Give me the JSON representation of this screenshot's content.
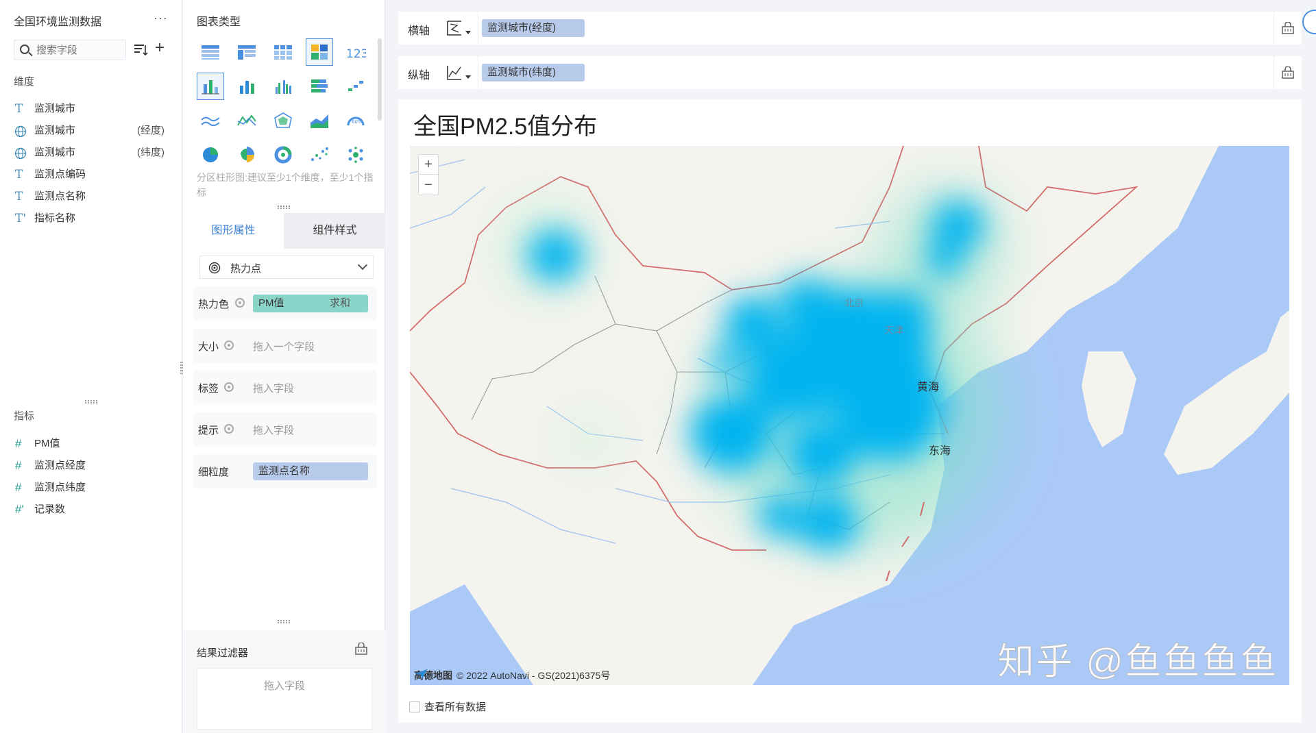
{
  "dataset": {
    "title": "全国环境监测数据",
    "more": "···",
    "search_placeholder": "搜索字段",
    "dimension_title": "维度",
    "dimensions": [
      {
        "name": "监测城市",
        "suffix": "",
        "type": "text"
      },
      {
        "name": "监测城市",
        "suffix": "(经度)",
        "type": "geo"
      },
      {
        "name": "监测城市",
        "suffix": "(纬度)",
        "type": "geo"
      },
      {
        "name": "监测点编码",
        "suffix": "",
        "type": "text"
      },
      {
        "name": "监测点名称",
        "suffix": "",
        "type": "text"
      },
      {
        "name": "指标名称",
        "suffix": "",
        "type": "text"
      }
    ],
    "measure_title": "指标",
    "measures": [
      {
        "name": "PM值"
      },
      {
        "name": "监测点经度"
      },
      {
        "name": "监测点纬度"
      },
      {
        "name": "记录数"
      }
    ]
  },
  "chart_types": {
    "title": "图表类型",
    "hint": "分区柱形图:建议至少1个维度，至少1个指标"
  },
  "tabs": [
    {
      "label": "图形属性",
      "active": true
    },
    {
      "label": "组件样式",
      "active": false
    }
  ],
  "graph": {
    "type_label": "热力点",
    "properties": [
      {
        "label": "热力色",
        "value": "PM值",
        "agg": "求和",
        "placeholder": ""
      },
      {
        "label": "大小",
        "value": "",
        "agg": "",
        "placeholder": "拖入一个字段"
      },
      {
        "label": "标签",
        "value": "",
        "agg": "",
        "placeholder": "拖入字段"
      },
      {
        "label": "提示",
        "value": "",
        "agg": "",
        "placeholder": "拖入字段"
      },
      {
        "label": "细粒度",
        "value": "监测点名称",
        "agg": "",
        "placeholder": ""
      }
    ]
  },
  "filter": {
    "title": "结果过滤器",
    "placeholder": "拖入字段"
  },
  "axes": {
    "x_label": "横轴",
    "x_field": "监测城市(经度)",
    "y_label": "纵轴",
    "y_field": "监测城市(纬度)"
  },
  "chart": {
    "title": "全国PM2.5值分布",
    "attribution": "© 2022 AutoNavi - GS(2021)6375号",
    "provider": "高德地图",
    "watermark": "知乎 @鱼鱼鱼鱼",
    "seas": [
      "黄海",
      "东海"
    ],
    "cities": [
      "北京",
      "天津"
    ],
    "show_all_label": "查看所有数据",
    "heat_color": "#00b4f0"
  }
}
